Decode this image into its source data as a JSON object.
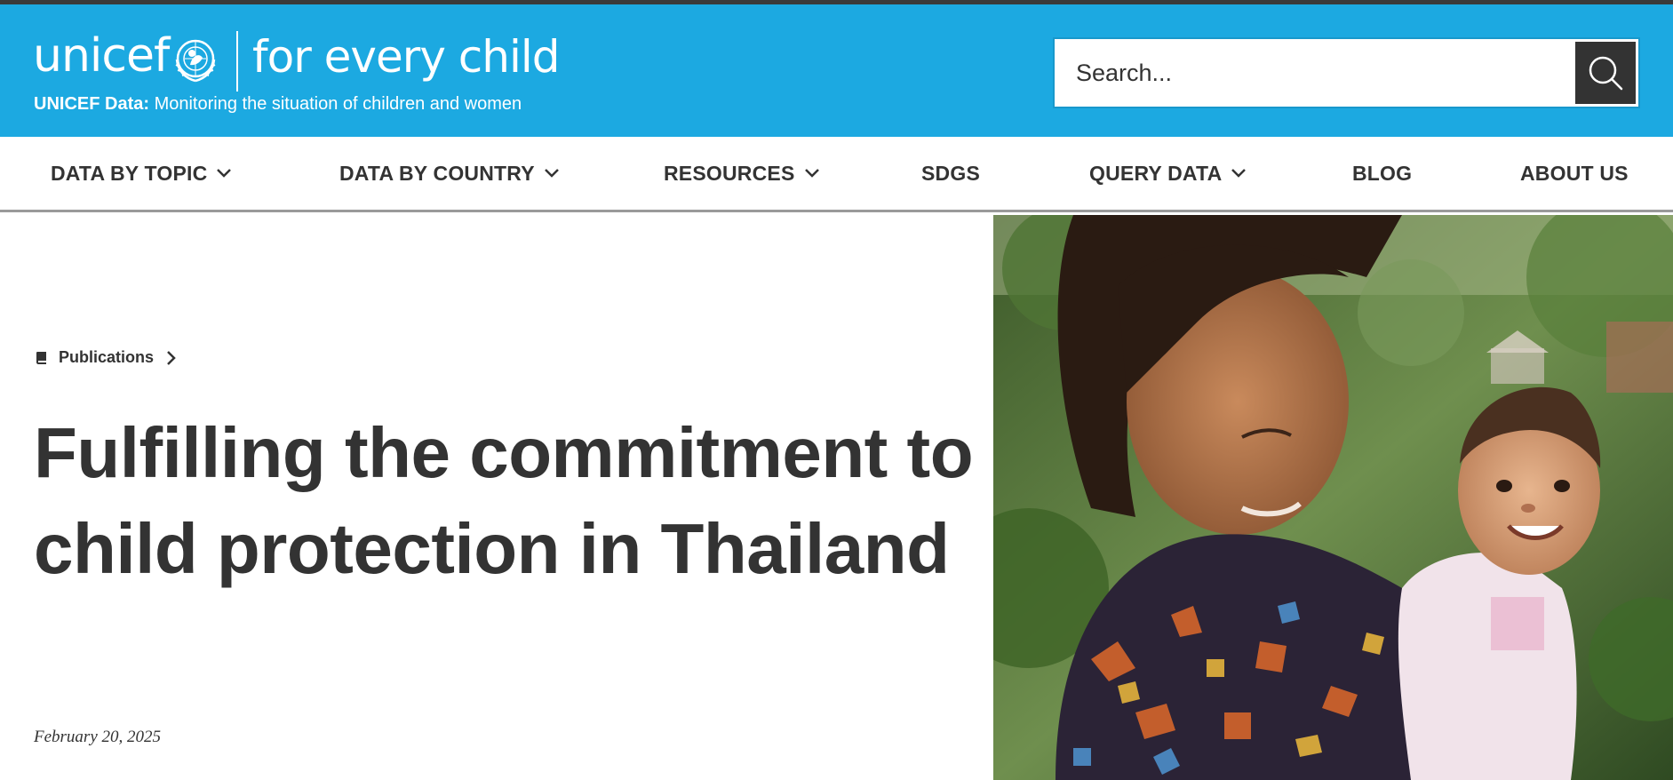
{
  "header": {
    "logo_word": "unicef",
    "logo_tagline": "for every child",
    "subtitle_bold": "UNICEF Data:",
    "subtitle_rest": " Monitoring the situation of children and women",
    "brand_color": "#1ca9e1"
  },
  "search": {
    "placeholder": "Search...",
    "icon": "search-icon"
  },
  "nav": {
    "items": [
      {
        "label": "DATA BY TOPIC",
        "has_dropdown": true
      },
      {
        "label": "DATA BY COUNTRY",
        "has_dropdown": true
      },
      {
        "label": "RESOURCES",
        "has_dropdown": true
      },
      {
        "label": "SDGS",
        "has_dropdown": false
      },
      {
        "label": "QUERY DATA",
        "has_dropdown": true
      },
      {
        "label": "BLOG",
        "has_dropdown": false
      },
      {
        "label": "ABOUT US",
        "has_dropdown": false
      }
    ]
  },
  "article": {
    "breadcrumb": "Publications",
    "breadcrumb_icon": "book-icon",
    "title": "Fulfilling the commitment to child protection in Thailand",
    "date": "February 20, 2025"
  }
}
